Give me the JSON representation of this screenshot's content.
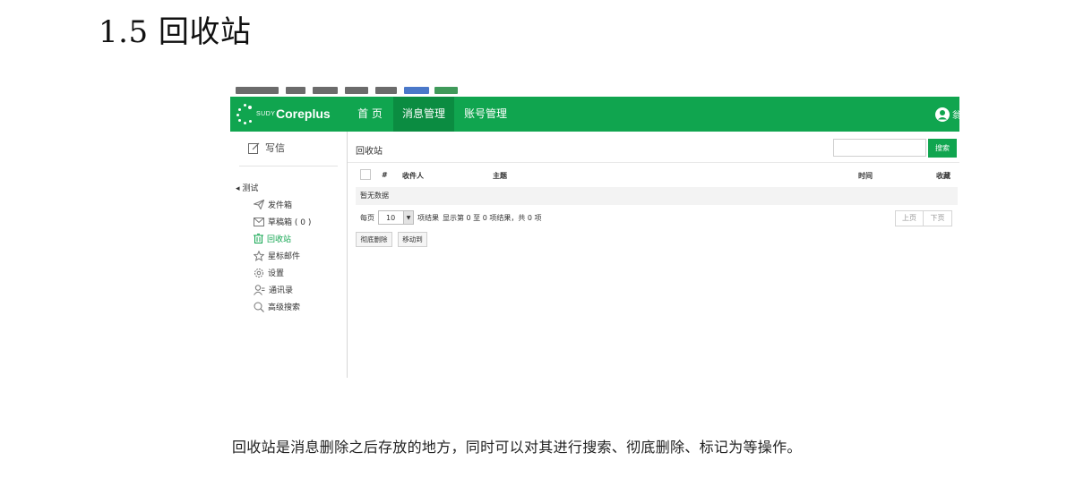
{
  "document": {
    "heading": "1.5 回收站",
    "caption": "回收站是消息删除之后存放的地方，同时可以对其进行搜索、彻底删除、标记为等操作。"
  },
  "app": {
    "logo_small": "SUDY",
    "logo_name": "Coreplus",
    "nav": [
      {
        "label": "首 页"
      },
      {
        "label": "消息管理"
      },
      {
        "label": "账号管理"
      }
    ],
    "user_trail": "翁",
    "sidebar": {
      "compose_label": "写信",
      "tree_root": "测试",
      "items": [
        {
          "label": "发件箱"
        },
        {
          "label": "草稿箱 ( 0 )"
        },
        {
          "label": "回收站"
        },
        {
          "label": "星标邮件"
        },
        {
          "label": "设置"
        },
        {
          "label": "通讯录"
        },
        {
          "label": "高级搜索"
        }
      ]
    },
    "main": {
      "title": "回收站",
      "search_button": "搜索",
      "table_headers": {
        "index": "#",
        "recipient": "收件人",
        "subject": "主题",
        "time": "时间",
        "starred": "收藏"
      },
      "empty_text": "暂无数据",
      "pager": {
        "per_page_prefix": "每页",
        "per_page_value": "10",
        "per_page_suffix": "项结果",
        "summary": "显示第 0 至 0 项结果，共 0 项",
        "prev": "上页",
        "next": "下页"
      },
      "actions": {
        "delete_forever": "彻底删除",
        "move_to": "移动到"
      }
    },
    "colors": {
      "brand_green": "#10a54f",
      "nav_active": "#0b8c41"
    }
  }
}
